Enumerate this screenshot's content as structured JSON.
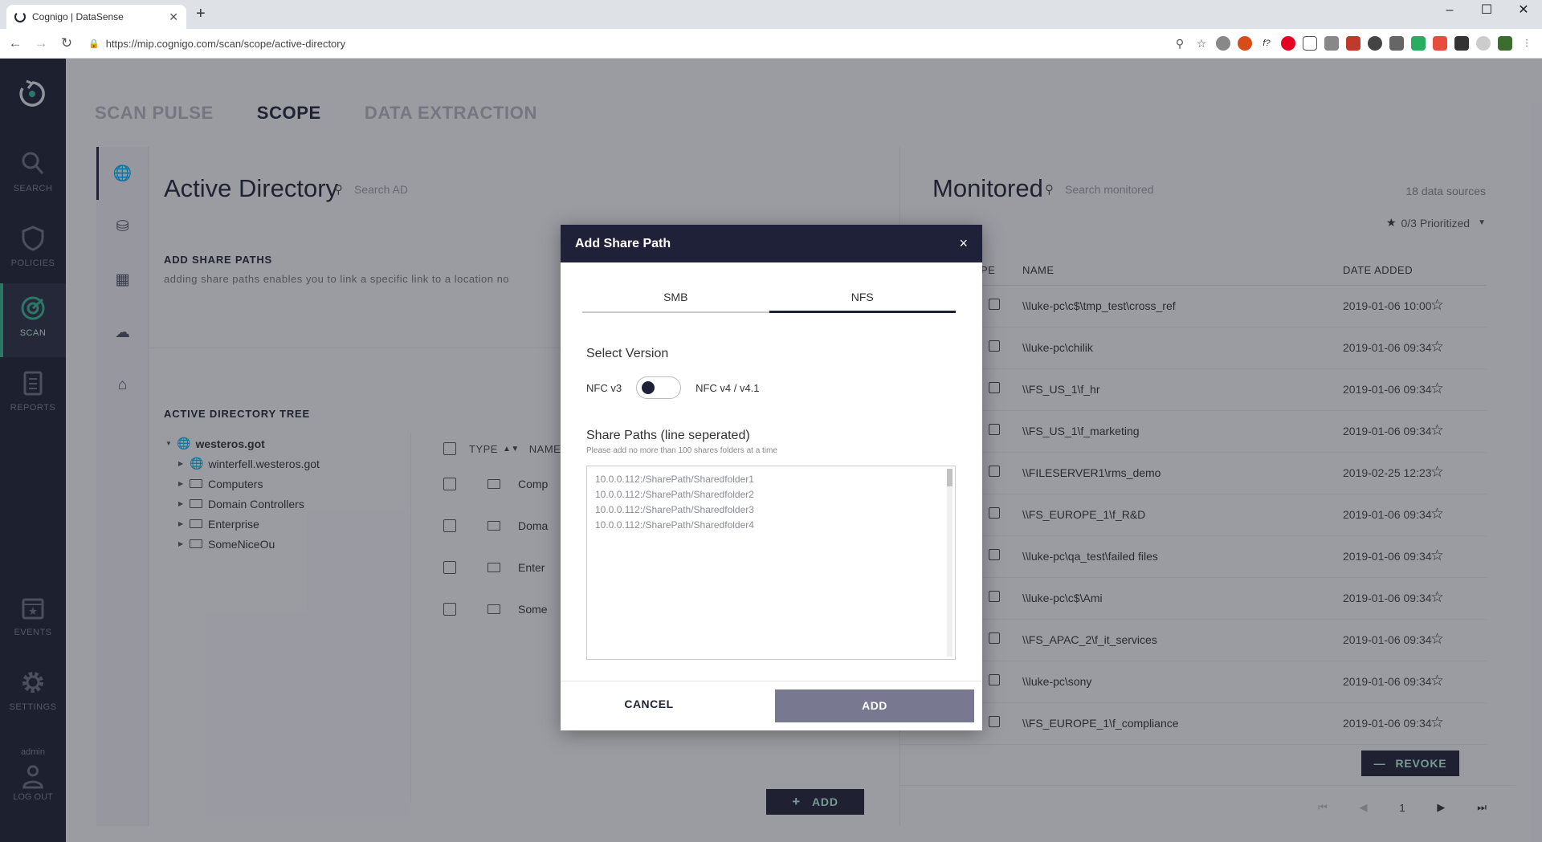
{
  "browser": {
    "tab_title": "Cognigo | DataSense",
    "url": "https://mip.cognigo.com/scan/scope/active-directory"
  },
  "sidebar": {
    "items": [
      {
        "label": "SEARCH"
      },
      {
        "label": "POLICIES"
      },
      {
        "label": "SCAN"
      },
      {
        "label": "REPORTS"
      },
      {
        "label": "EVENTS"
      },
      {
        "label": "SETTINGS"
      }
    ],
    "user": "admin",
    "logout": "LOG OUT"
  },
  "toptabs": [
    "SCAN PULSE",
    "SCOPE",
    "DATA EXTRACTION"
  ],
  "active_directory": {
    "title": "Active Directory",
    "search_placeholder": "Search AD",
    "add_share_paths_title": "ADD SHARE PATHS",
    "add_share_paths_desc": "adding share paths enables you to link a specific link to a location no",
    "tree_title": "ACTIVE DIRECTORY TREE",
    "tree": {
      "root": "westeros.got",
      "children": [
        "winterfell.westeros.got",
        "Computers",
        "Domain Controllers",
        "Enterprise",
        "SomeNiceOu"
      ]
    },
    "table": {
      "col_type": "TYPE",
      "col_name": "NAME",
      "rows": [
        "Comp",
        "Doma",
        "Enter",
        "Some"
      ]
    },
    "add_button": "ADD"
  },
  "monitored": {
    "title": "Monitored",
    "search_placeholder": "Search monitored",
    "count": "18 data sources",
    "prioritized": "0/3 Prioritized",
    "col_type": "PE",
    "col_name": "NAME",
    "col_date": "DATE ADDED",
    "rows": [
      {
        "name": "\\\\luke-pc\\c$\\tmp_test\\cross_ref",
        "date": "2019-01-06 10:00"
      },
      {
        "name": "\\\\luke-pc\\chilik",
        "date": "2019-01-06 09:34"
      },
      {
        "name": "\\\\FS_US_1\\f_hr",
        "date": "2019-01-06 09:34"
      },
      {
        "name": "\\\\FS_US_1\\f_marketing",
        "date": "2019-01-06 09:34"
      },
      {
        "name": "\\\\FILESERVER1\\rms_demo",
        "date": "2019-02-25 12:23"
      },
      {
        "name": "\\\\FS_EUROPE_1\\f_R&D",
        "date": "2019-01-06 09:34"
      },
      {
        "name": "\\\\luke-pc\\qa_test\\failed files",
        "date": "2019-01-06 09:34"
      },
      {
        "name": "\\\\luke-pc\\c$\\Ami",
        "date": "2019-01-06 09:34"
      },
      {
        "name": "\\\\FS_APAC_2\\f_it_services",
        "date": "2019-01-06 09:34"
      },
      {
        "name": "\\\\luke-pc\\sony",
        "date": "2019-01-06 09:34"
      },
      {
        "name": "\\\\FS_EUROPE_1\\f_compliance",
        "date": "2019-01-06 09:34"
      }
    ],
    "revoke_button": "REVOKE",
    "page": "1"
  },
  "modal": {
    "title": "Add Share Path",
    "tabs": [
      "SMB",
      "NFS"
    ],
    "active_tab": "NFS",
    "select_version_label": "Select Version",
    "version_left": "NFC v3",
    "version_right": "NFC v4 / v4.1",
    "share_paths_label": "Share Paths (line seperated)",
    "share_paths_hint": "Please add no more than 100 shares folders at a time",
    "placeholder_lines": [
      "10.0.0.112:/SharePath/Sharedfolder1",
      "10.0.0.112:/SharePath/Sharedfolder2",
      "10.0.0.112:/SharePath/Sharedfolder3",
      "10.0.0.112:/SharePath/Sharedfolder4"
    ],
    "cancel_button": "CANCEL",
    "add_button": "ADD"
  },
  "colors": {
    "sidebar_bg": "#1d2030",
    "accent_green": "#38b68f",
    "modal_header": "#1f2138",
    "add_button_bg": "#787890"
  }
}
